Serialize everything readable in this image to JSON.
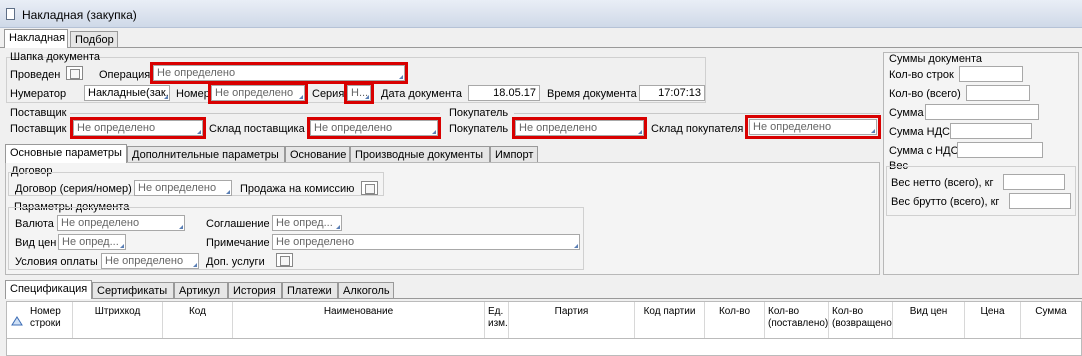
{
  "window": {
    "title": "Накладная (закупка)"
  },
  "top_tabs": [
    "Накладная",
    "Подбор"
  ],
  "header": {
    "group_title": "Шапка документа",
    "posted_label": "Проведен",
    "operation_label": "Операция",
    "operation_value": "Не определено",
    "numerator_label": "Нумератор",
    "numerator_value": "Накладные(зак...",
    "number_label": "Номер",
    "number_value": "Не определено",
    "series_label": "Серия",
    "series_value": "Н...",
    "doc_date_label": "Дата документа",
    "doc_date_value": "18.05.17",
    "doc_time_label": "Время документа",
    "doc_time_value": "17:07:13"
  },
  "supplier": {
    "group_title": "Поставщик",
    "supplier_label": "Поставщик",
    "supplier_value": "Не определено",
    "warehouse_label": "Склад поставщика",
    "warehouse_value": "Не определено"
  },
  "buyer": {
    "group_title": "Покупатель",
    "buyer_label": "Покупатель",
    "buyer_value": "Не определено",
    "warehouse_label": "Склад покупателя",
    "warehouse_value": "Не определено"
  },
  "totals": {
    "group_title": "Суммы документа",
    "rows_count_label": "Кол-во строк",
    "qty_total_label": "Кол-во (всего)",
    "sum_label": "Сумма",
    "vat_sum_label": "Сумма НДС",
    "sum_with_vat_label": "Сумма с НДС",
    "weight_group_title": "Вес",
    "net_weight_label": "Вес нетто (всего), кг",
    "gross_weight_label": "Вес брутто (всего), кг"
  },
  "param_tabs": [
    "Основные параметры",
    "Дополнительные параметры",
    "Основание",
    "Производные документы",
    "Импорт"
  ],
  "contract": {
    "group_title": "Договор",
    "contract_label": "Договор (серия/номер)",
    "contract_value": "Не определено",
    "commission_label": "Продажа на комиссию"
  },
  "doc_params": {
    "group_title": "Параметры документа",
    "currency_label": "Валюта",
    "currency_value": "Не определено",
    "agreement_label": "Соглашение",
    "agreement_value": "Не опред...",
    "price_type_label": "Вид цен",
    "price_type_value": "Не опред...",
    "note_label": "Примечание",
    "note_value": "Не определено",
    "payment_label": "Условия оплаты",
    "payment_value": "Не определено",
    "extra_services_label": "Доп. услуги"
  },
  "bottom_tabs": [
    "Спецификация",
    "Сертификаты",
    "Артикул",
    "История",
    "Платежи",
    "Алкоголь"
  ],
  "grid_columns": [
    "Номер строки",
    "Штрихкод",
    "Код",
    "Наименование",
    "Ед. изм.",
    "Партия",
    "Код партии",
    "Кол-во",
    "Кол-во (поставлено)",
    "Кол-во (возвращено)",
    "Вид цен",
    "Цена",
    "Сумма"
  ]
}
